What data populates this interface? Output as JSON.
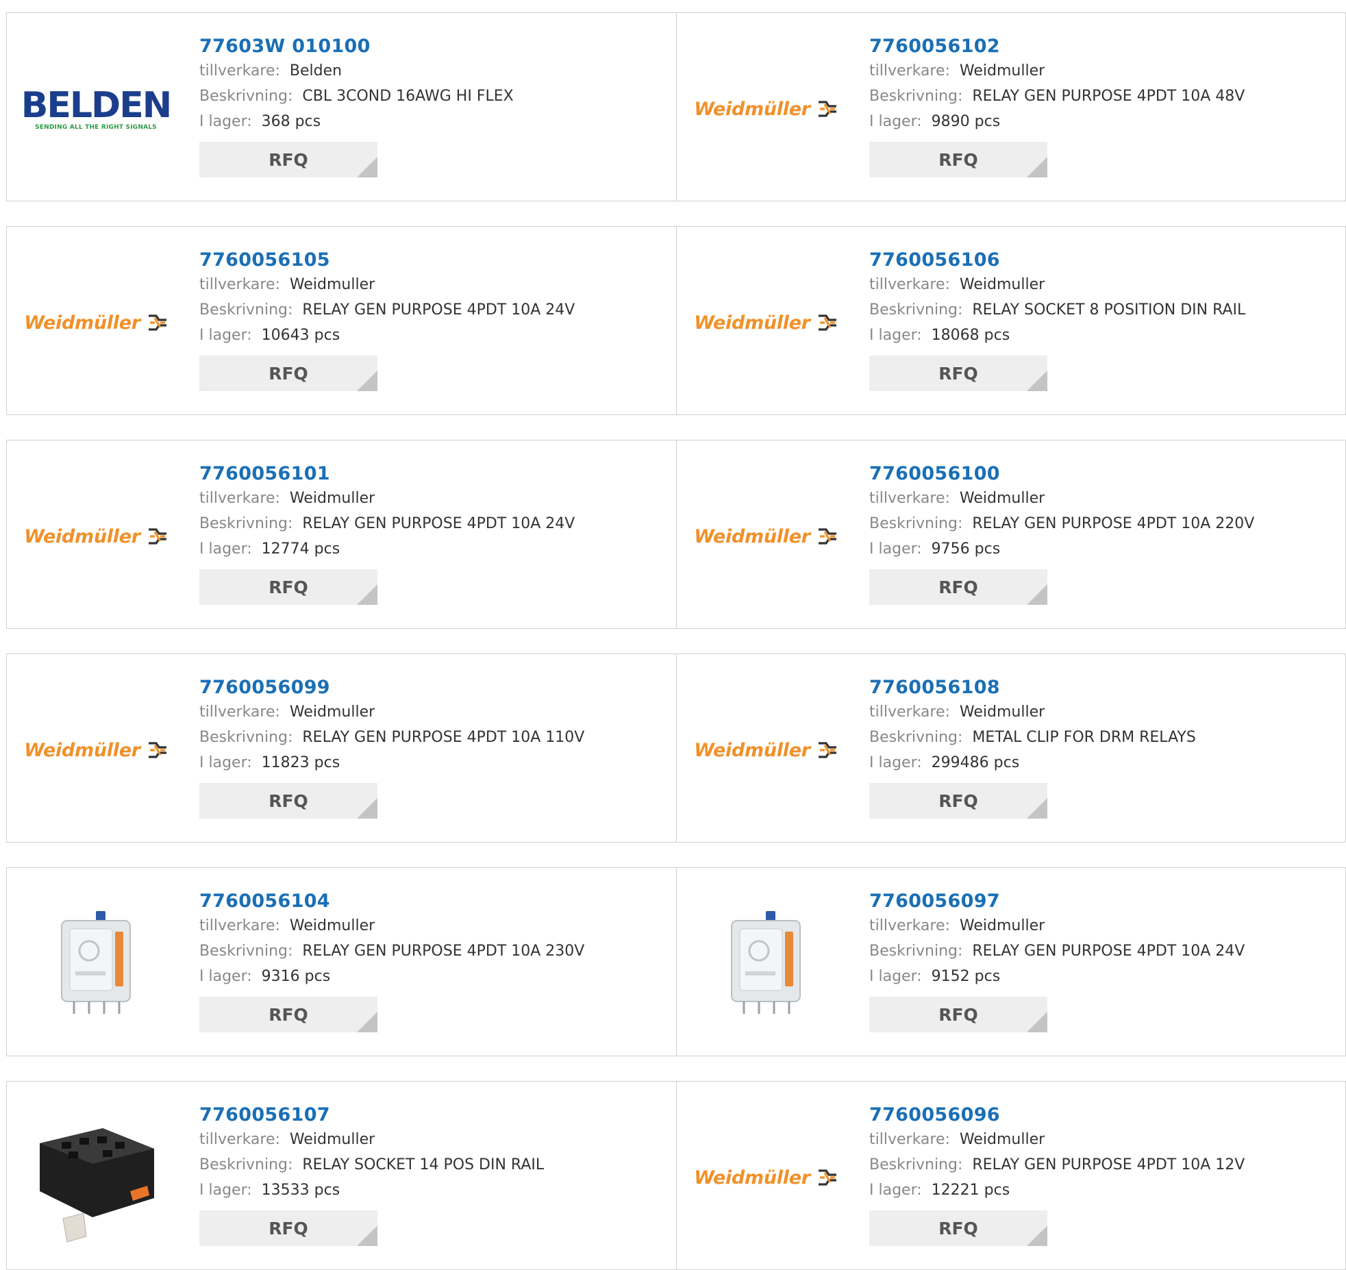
{
  "labels": {
    "manufacturer": "tillverkare:",
    "description": "Beskrivning:",
    "stock": "I lager:",
    "unit": "pcs",
    "rfq": "RFQ"
  },
  "brands": {
    "weidmuller_logo_text": "Weidmüller",
    "belden_logo_text": "BELDEN",
    "belden_tagline": "SENDING ALL THE RIGHT SIGNALS"
  },
  "colors": {
    "part_link": "#1a6fb5",
    "weidmuller_orange": "#f0912a",
    "belden_blue": "#1b3e8c",
    "belden_green": "#2f9a44",
    "rfq_bg": "#eeeeee"
  },
  "products": [
    {
      "part": "77603W 010100",
      "manufacturer": "Belden",
      "description": "CBL 3COND 16AWG HI FLEX",
      "stock": "368",
      "image": "belden-logo"
    },
    {
      "part": "7760056102",
      "manufacturer": "Weidmuller",
      "description": "RELAY GEN PURPOSE 4PDT 10A 48V",
      "stock": "9890",
      "image": "weidmuller-logo"
    },
    {
      "part": "7760056105",
      "manufacturer": "Weidmuller",
      "description": "RELAY GEN PURPOSE 4PDT 10A 24V",
      "stock": "10643",
      "image": "weidmuller-logo"
    },
    {
      "part": "7760056106",
      "manufacturer": "Weidmuller",
      "description": "RELAY SOCKET 8 POSITION DIN RAIL",
      "stock": "18068",
      "image": "weidmuller-logo"
    },
    {
      "part": "7760056101",
      "manufacturer": "Weidmuller",
      "description": "RELAY GEN PURPOSE 4PDT 10A 24V",
      "stock": "12774",
      "image": "weidmuller-logo"
    },
    {
      "part": "7760056100",
      "manufacturer": "Weidmuller",
      "description": "RELAY GEN PURPOSE 4PDT 10A 220V",
      "stock": "9756",
      "image": "weidmuller-logo"
    },
    {
      "part": "7760056099",
      "manufacturer": "Weidmuller",
      "description": "RELAY GEN PURPOSE 4PDT 10A 110V",
      "stock": "11823",
      "image": "weidmuller-logo"
    },
    {
      "part": "7760056108",
      "manufacturer": "Weidmuller",
      "description": "METAL CLIP FOR DRM RELAYS",
      "stock": "299486",
      "image": "weidmuller-logo"
    },
    {
      "part": "7760056104",
      "manufacturer": "Weidmuller",
      "description": "RELAY GEN PURPOSE 4PDT 10A 230V",
      "stock": "9316",
      "image": "relay-photo"
    },
    {
      "part": "7760056097",
      "manufacturer": "Weidmuller",
      "description": "RELAY GEN PURPOSE 4PDT 10A 24V",
      "stock": "9152",
      "image": "relay-photo"
    },
    {
      "part": "7760056107",
      "manufacturer": "Weidmuller",
      "description": "RELAY SOCKET 14 POS DIN RAIL",
      "stock": "13533",
      "image": "socket-photo"
    },
    {
      "part": "7760056096",
      "manufacturer": "Weidmuller",
      "description": "RELAY GEN PURPOSE 4PDT 10A 12V",
      "stock": "12221",
      "image": "weidmuller-logo"
    }
  ]
}
